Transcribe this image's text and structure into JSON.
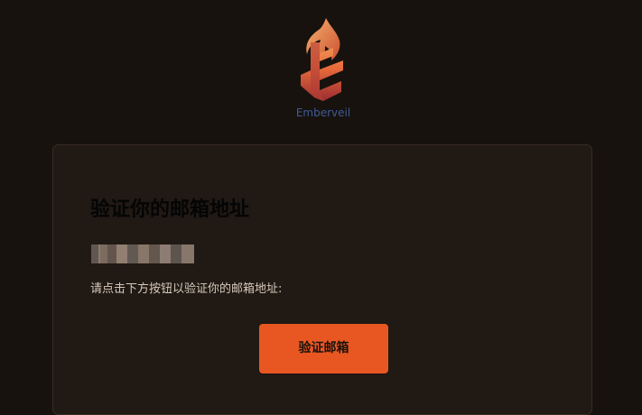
{
  "brand": {
    "name": "Emberveil",
    "accent_color": "#e85722"
  },
  "email": {
    "title": "验证你的邮箱地址",
    "instruction": "请点击下方按钮以验证你的邮箱地址:",
    "button_label": "验证邮箱"
  }
}
